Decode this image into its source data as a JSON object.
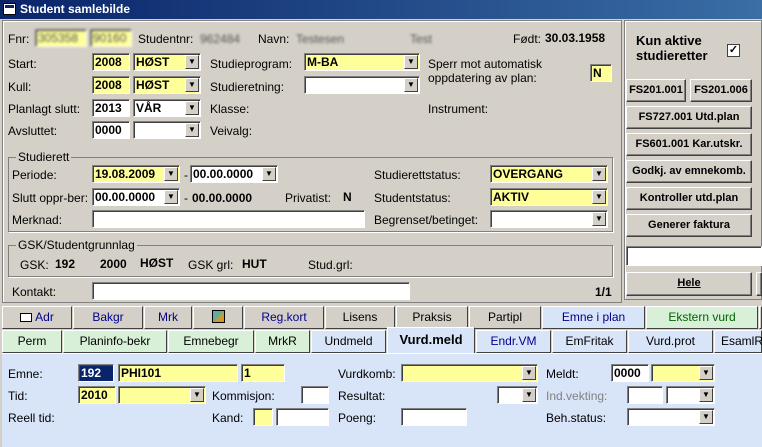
{
  "window": {
    "title": "Student samlebilde"
  },
  "header": {
    "fnr_label": "Fnr:",
    "fnr_value1": "305358",
    "fnr_value2": "90160",
    "studentnr_label": "Studentnr:",
    "studentnr_value": "962484",
    "navn_label": "Navn:",
    "navn_first": "Testesen",
    "navn_last": "Test",
    "fodt_label": "Født:",
    "fodt_value": "30.03.1958"
  },
  "form": {
    "start_label": "Start:",
    "start_year": "2008",
    "start_term": "HØST",
    "kull_label": "Kull:",
    "kull_year": "2008",
    "kull_term": "HØST",
    "planlagt_label": "Planlagt slutt:",
    "planlagt_year": "2013",
    "planlagt_term": "VÅR",
    "avsluttet_label": "Avsluttet:",
    "avsluttet_year": "0000",
    "avsluttet_term": "",
    "studieprogram_label": "Studieprogram:",
    "studieprogram_value": "M-BA",
    "studieretning_label": "Studieretning:",
    "studieretning_value": "",
    "klasse_label": "Klasse:",
    "veivalg_label": "Veivalg:",
    "sperr_label": "Sperr mot automatisk oppdatering av plan:",
    "sperr_value": "N",
    "instrument_label": "Instrument:"
  },
  "studierett": {
    "title": "Studierett",
    "periode_label": "Periode:",
    "periode_from": "19.08.2009",
    "periode_dash": "-",
    "periode_to": "00.00.0000",
    "slutt_label": "Slutt oppr-ber:",
    "slutt_from": "00.00.0000",
    "slutt_dash": "-",
    "slutt_to": "00.00.0000",
    "privatist_label": "Privatist:",
    "privatist_value": "N",
    "merknad_label": "Merknad:",
    "status_label": "Studierettstatus:",
    "status_value": "OVERGANG",
    "studentstatus_label": "Studentstatus:",
    "studentstatus_value": "AKTIV",
    "begrenset_label": "Begrenset/betinget:"
  },
  "gsk": {
    "title": "GSK/Studentgrunnlag",
    "gsk_label": "GSK:",
    "gsk_value": "192",
    "gsk_year": "2000",
    "gsk_term": "HØST",
    "gskgrl_label": "GSK grl:",
    "gskgrl_value": "HUT",
    "studgrl_label": "Stud.grl:"
  },
  "kontakt": {
    "label": "Kontakt:",
    "pager": "1/1"
  },
  "rightpanel": {
    "kun_aktive_label": "Kun aktive studieretter",
    "kun_aktive_checked": "✓",
    "buttons": [
      "FS201.001",
      "FS201.006",
      "FS727.001 Utd.plan",
      "FS601.001 Kar.utskr.",
      "Godkj. av emnekomb.",
      "Kontroller utd.plan",
      "Generer faktura"
    ],
    "hele_label": "Hele"
  },
  "tabs_row1": [
    "Adr",
    "Bakgr",
    "Mrk",
    "",
    "Reg.kort",
    "Lisens",
    "Praksis",
    "Partipl",
    "Emne i plan",
    "Ekstern vurd"
  ],
  "tabs_row2": [
    "Perm",
    "Planinfo-bekr",
    "Emnebegr",
    "MrkR",
    "Undmeld",
    "Vurd.meld",
    "Endr.VM",
    "EmFritak",
    "Vurd.prot",
    "EsamlR"
  ],
  "vurd": {
    "emne_label": "Emne:",
    "emne_inst": "192",
    "emne_code": "PHI101",
    "emne_ver": "1",
    "tid_label": "Tid:",
    "tid_year": "2010",
    "tid_term": "",
    "reell_label": "Reell tid:",
    "kommisjon_label": "Kommisjon:",
    "kand_label": "Kand:",
    "vurdkomb_label": "Vurdkomb:",
    "resultat_label": "Resultat:",
    "poeng_label": "Poeng:",
    "meldt_label": "Meldt:",
    "meldt_value": "0000",
    "indvekting_label": "Ind.vekting:",
    "behstatus_label": "Beh.status:"
  }
}
